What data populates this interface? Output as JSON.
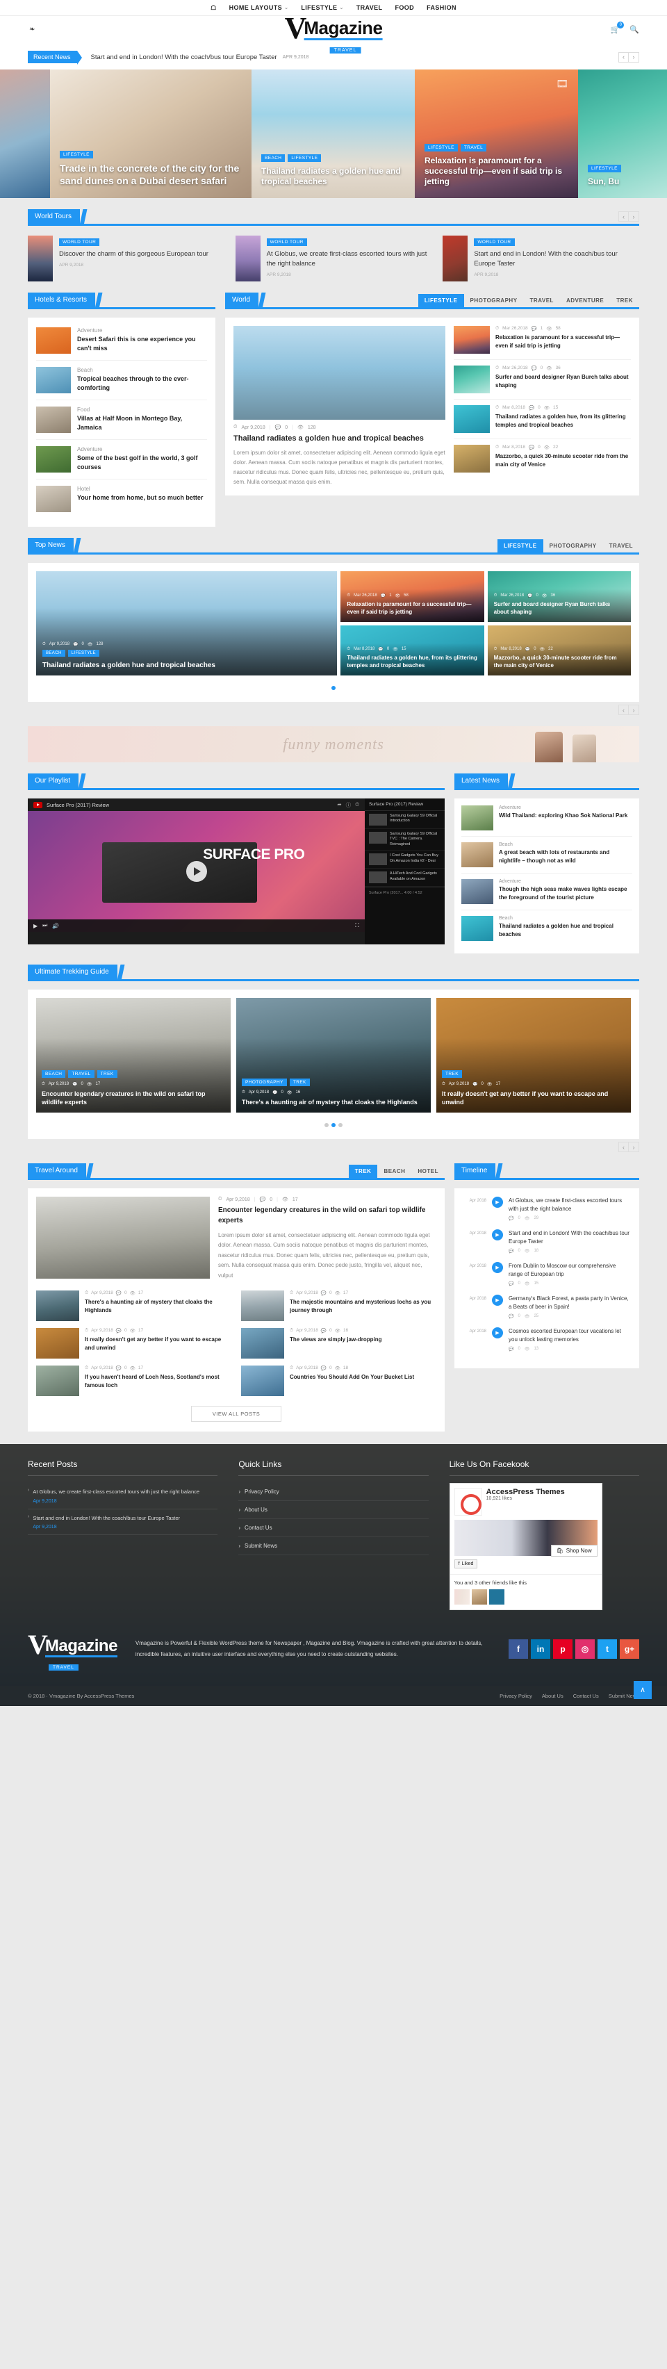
{
  "topnav": {
    "home_icon": "home-icon",
    "items": [
      {
        "label": "HOME LAYOUTS",
        "caret": "⌵"
      },
      {
        "label": "LIFESTYLE",
        "caret": "⌵"
      },
      {
        "label": "TRAVEL",
        "caret": ""
      },
      {
        "label": "FOOD",
        "caret": ""
      },
      {
        "label": "FASHION",
        "caret": ""
      }
    ]
  },
  "header": {
    "share_icon": "share-icon",
    "logo_v": "V",
    "logo_name": "Magazine",
    "logo_sub": "TRAVEL",
    "cart_icon": "cart-icon",
    "cart_count": "0",
    "search_icon": "search-icon"
  },
  "breaking": {
    "label": "Recent News",
    "text": "Start and end in London! With the coach/bus tour Europe Taster",
    "date": "APR 9,2018",
    "prev": "‹",
    "next": "›"
  },
  "hero": {
    "slides": [
      {
        "tags": [],
        "title": "",
        "bg": "g-venice",
        "video": false
      },
      {
        "tags": [
          "LIFESTYLE"
        ],
        "title": "Trade in the concrete of the city for the sand dunes on a Dubai desert safari",
        "bg": "g-dubai",
        "video": false
      },
      {
        "tags": [
          "BEACH",
          "LIFESTYLE"
        ],
        "title": "Thailand radiates a golden hue and tropical beaches",
        "bg": "g-thai",
        "video": false
      },
      {
        "tags": [
          "LIFESTYLE",
          "TRAVEL"
        ],
        "title": "Relaxation is paramount for a successful trip—even if said trip is jetting",
        "bg": "g-sunset",
        "video": true
      },
      {
        "tags": [
          "LIFESTYLE"
        ],
        "title": "Sun, Bu",
        "bg": "g-surf",
        "video": false
      }
    ]
  },
  "world_tours": {
    "title": "World Tours",
    "prev": "‹",
    "next": "›",
    "items": [
      {
        "tag": "WORLD TOUR",
        "title": "Discover the charm of this gorgeous European tour",
        "date": "APR 9,2018",
        "bg": "g-euro"
      },
      {
        "tag": "WORLD TOUR",
        "title": "At Globus, we create first-class escorted tours with just the right balance",
        "date": "APR 9,2018",
        "bg": "g-globus"
      },
      {
        "tag": "WORLD TOUR",
        "title": "Start and end in London! With the coach/bus tour Europe Taster",
        "date": "APR 9,2018",
        "bg": "g-london"
      }
    ]
  },
  "hotels": {
    "title": "Hotels & Resorts",
    "items": [
      {
        "cat": "Adventure",
        "title": "Desert Safari this is one experience you can't miss",
        "bg": "g-desert"
      },
      {
        "cat": "Beach",
        "title": "Tropical beaches through to the ever-comforting",
        "bg": "g-pool"
      },
      {
        "cat": "Food",
        "title": "Villas at Half Moon in Montego Bay, Jamaica",
        "bg": "g-villa"
      },
      {
        "cat": "Adventure",
        "title": "Some of the best golf in the world, 3 golf courses",
        "bg": "g-golf"
      },
      {
        "cat": "Hotel",
        "title": "Your home from home, but so much better",
        "bg": "g-hotel"
      }
    ]
  },
  "world": {
    "title": "World",
    "tabs": [
      {
        "label": "LIFESTYLE",
        "active": true
      },
      {
        "label": "PHOTOGRAPHY",
        "active": false
      },
      {
        "label": "TRAVEL",
        "active": false
      },
      {
        "label": "ADVENTURE",
        "active": false
      },
      {
        "label": "TREK",
        "active": false
      }
    ],
    "feature": {
      "date": "Apr 9,2018",
      "comments": "0",
      "views": "128",
      "title": "Thailand radiates a golden hue and tropical beaches",
      "excerpt": "Lorem ipsum dolor sit amet, consectetuer adipiscing elit. Aenean commodo ligula eget dolor. Aenean massa. Cum sociis natoque penatibus et magnis dis parturient montes, nascetur ridiculus mus. Donec quam felis, ultricies nec, pellentesque eu, pretium quis, sem. Nulla consequat massa quis enim.",
      "bg": "g-beachtop"
    },
    "side": [
      {
        "date": "Mar 26,2018",
        "comments": "1",
        "views": "58",
        "title": "Relaxation is paramount for a successful trip—even if said trip is jetting",
        "bg": "g-sunset"
      },
      {
        "date": "Mar 26,2018",
        "comments": "0",
        "views": "36",
        "title": "Surfer and board designer Ryan Burch talks about shaping",
        "bg": "g-surf"
      },
      {
        "date": "Mar 8,2018",
        "comments": "0",
        "views": "15",
        "title": "Thailand radiates a golden hue, from its glittering temples and tropical beaches",
        "bg": "g-boats"
      },
      {
        "date": "Mar 8,2018",
        "comments": "0",
        "views": "22",
        "title": "Mazzorbo, a quick 30-minute scooter ride from the main city of Venice",
        "bg": "g-street"
      }
    ]
  },
  "top_news": {
    "title": "Top News",
    "tabs": [
      {
        "label": "LIFESTYLE",
        "active": true
      },
      {
        "label": "PHOTOGRAPHY",
        "active": false
      },
      {
        "label": "TRAVEL",
        "active": false
      }
    ],
    "big": {
      "tags": [
        "BEACH",
        "LIFESTYLE"
      ],
      "date": "Apr 9,2018",
      "comments": "0",
      "views": "128",
      "title": "Thailand radiates a golden hue and tropical beaches",
      "bg": "g-beachtop"
    },
    "cards": [
      {
        "date": "Mar 26,2018",
        "comments": "1",
        "views": "58",
        "title": "Relaxation is paramount for a successful trip—even if said trip is jetting",
        "bg": "g-sunset"
      },
      {
        "date": "Mar 8,2018",
        "comments": "0",
        "views": "15",
        "title": "Thailand radiates a golden hue, from its glittering temples and tropical beaches",
        "bg": "g-boats"
      },
      {
        "date": "Mar 26,2018",
        "comments": "0",
        "views": "36",
        "title": "Surfer and board designer Ryan Burch talks about shaping",
        "bg": "g-surf"
      },
      {
        "date": "Mar 8,2018",
        "comments": "0",
        "views": "22",
        "title": "Mazzorbo, a quick 30-minute scooter ride from the main city of Venice",
        "bg": "g-street"
      }
    ],
    "prev": "‹",
    "next": "›"
  },
  "banner": {
    "text": "funny moments"
  },
  "playlist": {
    "title": "Our Playlist",
    "video_title": "Surface Pro (2017) Review",
    "overlay_title": "SURFACE PRO",
    "list_head": "Surface Pro (2017) Review",
    "list_items": [
      {
        "title": "Samsung Galaxy S9 Official Introduction"
      },
      {
        "title": "Samsung Galaxy S9 Official TVC : The Camera. Reimagined"
      },
      {
        "title": "I Cost Gadgets You Can Buy On Amazon India #2 - Desi"
      },
      {
        "title": "A HiTech And Cool Gadgets Available on Amazon"
      }
    ],
    "list_footer": "Surface Pro (2017...\n4:00 / 4:52",
    "controls": {
      "play": "▶",
      "next": "⏭",
      "volume": "🔊",
      "full": "⛶"
    }
  },
  "latest_news": {
    "title": "Latest News",
    "items": [
      {
        "cat": "Adventure",
        "title": "Wild Thailand: exploring Khao Sok National Park",
        "bg": "g-nat"
      },
      {
        "cat": "Beach",
        "title": "A great beach with lots of restaurants and nightlife – though not as wild",
        "bg": "g-pool"
      },
      {
        "cat": "Adventure",
        "title": "Though the high seas make waves lights escape the foreground of the tourist picture",
        "bg": "g-light"
      },
      {
        "cat": "Beach",
        "title": "Thailand radiates a golden hue and tropical beaches",
        "bg": "g-boats"
      }
    ]
  },
  "trekking": {
    "title": "Ultimate Trekking Guide",
    "items": [
      {
        "tags": [
          "BEACH",
          "TRAVEL",
          "TREK"
        ],
        "date": "Apr 9,2018",
        "comments": "0",
        "views": "17",
        "title": "Encounter legendary creatures in the wild on safari top wildlife experts",
        "bg": "g-safari"
      },
      {
        "tags": [
          "PHOTOGRAPHY",
          "TREK"
        ],
        "date": "Apr 9,2018",
        "comments": "0",
        "views": "16",
        "title": "There's a haunting air of mystery that cloaks the Highlands",
        "bg": "g-highland"
      },
      {
        "tags": [
          "TREK"
        ],
        "date": "Apr 9,2018",
        "comments": "0",
        "views": "17",
        "title": "It really doesn't get any better if you want to escape and unwind",
        "bg": "g-cow"
      }
    ],
    "dots": 3,
    "active_dot": 1,
    "prev": "‹",
    "next": "›"
  },
  "travel_around": {
    "title": "Travel Around",
    "tabs": [
      {
        "label": "TREK",
        "active": true
      },
      {
        "label": "BEACH",
        "active": false
      },
      {
        "label": "HOTEL",
        "active": false
      }
    ],
    "feature": {
      "date": "Apr 9,2018",
      "comments": "0",
      "views": "17",
      "title": "Encounter legendary creatures in the wild on safari top wildlife experts",
      "excerpt": "Lorem ipsum dolor sit amet, consectetuer adipiscing elit. Aenean commodo ligula eget dolor. Aenean massa. Cum sociis natoque penatibus et magnis dis parturient montes, nascetur ridiculus mus. Donec quam felis, ultricies nec, pellentesque eu, pretium quis, sem. Nulla consequat massa quis enim. Donec pede justo, fringilla vel, aliquet nec, vulput",
      "bg": "g-safari"
    },
    "grid": [
      {
        "date": "Apr 9,2018",
        "comments": "0",
        "views": "17",
        "title": "There's a haunting air of mystery that cloaks the Highlands",
        "bg": "g-highland"
      },
      {
        "date": "Apr 9,2018",
        "comments": "0",
        "views": "17",
        "title": "The majestic mountains and mysterious lochs as you journey through",
        "bg": "g-mountain"
      },
      {
        "date": "Apr 9,2018",
        "comments": "0",
        "views": "17",
        "title": "It really doesn't get any better if you want to escape and unwind",
        "bg": "g-cow"
      },
      {
        "date": "Apr 9,2018",
        "comments": "0",
        "views": "16",
        "title": "The views are simply jaw-dropping",
        "bg": "g-fjord"
      },
      {
        "date": "Apr 9,2018",
        "comments": "0",
        "views": "17",
        "title": "If you haven't heard of Loch Ness, Scotland's most famous loch",
        "bg": "g-scot"
      },
      {
        "date": "Apr 9,2018",
        "comments": "0",
        "views": "18",
        "title": "Countries You Should Add On Your Bucket List",
        "bg": "g-bucket"
      }
    ],
    "view_all": "VIEW ALL POSTS"
  },
  "timeline": {
    "title": "Timeline",
    "items": [
      {
        "date": "Apr 2018",
        "title": "At Globus, we create first-class escorted tours with just the right balance",
        "comments": "0",
        "views": "29"
      },
      {
        "date": "Apr 2018",
        "title": "Start and end in London! With the coach/bus tour Europe Taster",
        "comments": "0",
        "views": "18"
      },
      {
        "date": "Apr 2018",
        "title": "From Dublin to Moscow our comprehensive range of European trip",
        "comments": "0",
        "views": "15"
      },
      {
        "date": "Apr 2018",
        "title": "Germany's Black Forest, a pasta party in Venice, a Beats of beer in Spain!",
        "comments": "0",
        "views": "25"
      },
      {
        "date": "Apr 2018",
        "title": "Cosmos escorted European tour vacations let you unlock lasting memories",
        "comments": "0",
        "views": "13"
      }
    ]
  },
  "footer": {
    "recent_posts_title": "Recent Posts",
    "recent_posts": [
      {
        "title": "At Globus, we create first-class escorted tours with just the right balance",
        "date": "Apr 9,2018"
      },
      {
        "title": "Start and end in London! With the coach/bus tour Europe Taster",
        "date": "Apr 9,2018"
      }
    ],
    "quick_links_title": "Quick Links",
    "quick_links": [
      "Privacy Policy",
      "About Us",
      "Contact Us",
      "Submit News"
    ],
    "facebook_title": "Like Us On Facekook",
    "fb_page": "AccessPress Themes",
    "fb_likes": "10,921 likes",
    "fb_liked": "Liked",
    "fb_shop": "Shop Now",
    "fb_friends": "You and 3 other friends like this",
    "logo_v": "V",
    "logo_name": "Magazine",
    "logo_sub": "TRAVEL",
    "description": "Vmagazine is Powerful & Flexible WordPress theme for Newspaper , Magazine and Blog. Vmagazine is crafted with great attention to details, incredible features, an intuitive user interface and everything else you need to create outstanding websites.",
    "social": [
      {
        "name": "facebook-icon",
        "glyph": "f",
        "color": "#3b5998"
      },
      {
        "name": "linkedin-icon",
        "glyph": "in",
        "color": "#0077b5"
      },
      {
        "name": "pinterest-icon",
        "glyph": "p",
        "color": "#e60023"
      },
      {
        "name": "instagram-icon",
        "glyph": "◎",
        "color": "#e1306c"
      },
      {
        "name": "twitter-icon",
        "glyph": "t",
        "color": "#1da1f2"
      },
      {
        "name": "googleplus-icon",
        "glyph": "g+",
        "color": "#e8573f"
      }
    ],
    "copyright": "© 2018 · Vmagazine By AccessPress Themes",
    "bottom_links": [
      "Privacy Policy",
      "About Us",
      "Contact Us",
      "Submit News"
    ],
    "to_top": "∧"
  },
  "icons": {
    "clock": "◷",
    "comment": "💬",
    "eye": "👁",
    "chevron": "›"
  }
}
